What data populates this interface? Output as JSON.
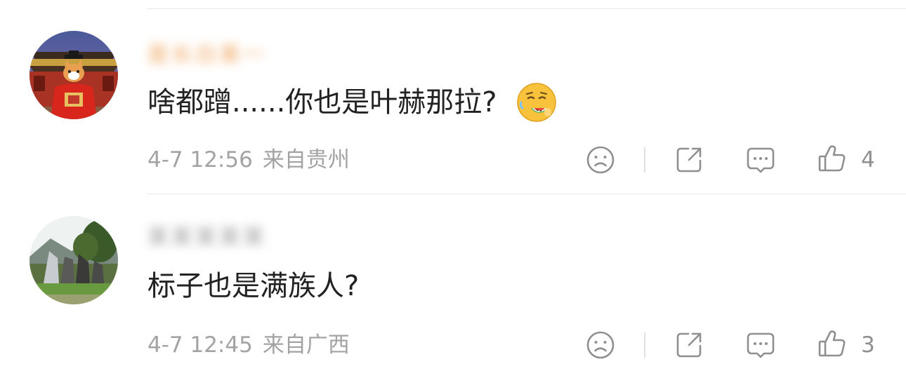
{
  "comments": [
    {
      "username": "是长白某一",
      "text": "啥都蹭......你也是叶赫那拉?",
      "emoji": "sweating-face-eating-watermelon-icon",
      "time": "4-7 12:56",
      "location": "来自贵州",
      "likes": "4"
    },
    {
      "username": "某某某某某",
      "text": "标子也是满族人?",
      "time": "4-7 12:45",
      "location": "来自广西",
      "likes": "3"
    }
  ],
  "colors": {
    "meta_text": "#a3a3a3",
    "icon_stroke": "#8f8f8f",
    "divider": "#e6e6e6",
    "username_blur": "#f0a35a"
  }
}
